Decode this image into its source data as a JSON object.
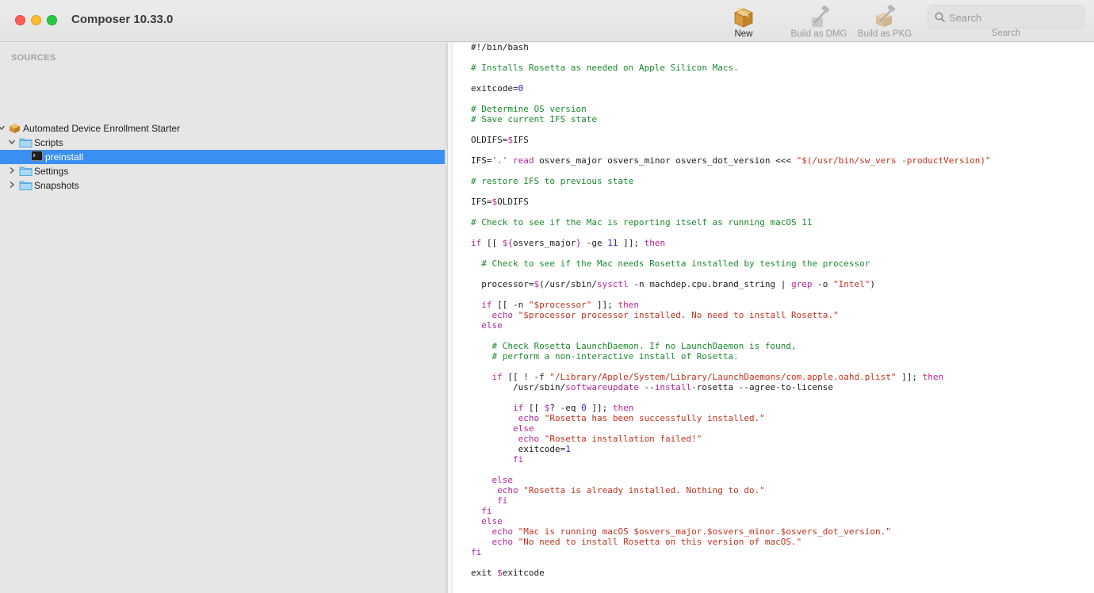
{
  "app": {
    "title": "Composer 10.33.0"
  },
  "toolbar": {
    "new_label": "New",
    "dmg_label": "Build as DMG",
    "pkg_label": "Build as PKG",
    "search_placeholder": "Search",
    "search_caption": "Search"
  },
  "sidebar": {
    "header": "SOURCES",
    "package": "Automated Device Enrollment Starter",
    "items": {
      "scripts": "Scripts",
      "preinstall": "preinstall",
      "settings": "Settings",
      "snapshots": "Snapshots"
    }
  },
  "colors": {
    "comment": "#1c8a2e",
    "keyword": "#b4269a",
    "string": "#c2321f",
    "number": "#2727c9",
    "selection": "#3a8ff2"
  },
  "script_lines": [
    [
      [
        "t",
        "#!/bin/bash"
      ]
    ],
    [],
    [
      [
        "c",
        "# Installs Rosetta as needed on Apple Silicon Macs."
      ]
    ],
    [],
    [
      [
        "t",
        "exitcode="
      ],
      [
        "n",
        "0"
      ]
    ],
    [],
    [
      [
        "c",
        "# Determine OS version"
      ]
    ],
    [
      [
        "c",
        "# Save current IFS state"
      ]
    ],
    [],
    [
      [
        "t",
        "OLDIFS="
      ],
      [
        "k",
        "$"
      ],
      [
        "t",
        "IFS"
      ]
    ],
    [],
    [
      [
        "t",
        "IFS="
      ],
      [
        "s",
        "'.'"
      ],
      [
        "t",
        " "
      ],
      [
        "k",
        "read"
      ],
      [
        "t",
        " osvers_major osvers_minor osvers_dot_version <<< "
      ],
      [
        "s",
        "\"$(/usr/bin/sw_vers -productVersion)\""
      ]
    ],
    [],
    [
      [
        "c",
        "# restore IFS to previous state"
      ]
    ],
    [],
    [
      [
        "t",
        "IFS="
      ],
      [
        "k",
        "$"
      ],
      [
        "t",
        "OLDIFS"
      ]
    ],
    [],
    [
      [
        "c",
        "# Check to see if the Mac is reporting itself as running macOS 11"
      ]
    ],
    [],
    [
      [
        "k",
        "if"
      ],
      [
        "t",
        " [[ "
      ],
      [
        "k",
        "${"
      ],
      [
        "t",
        "osvers_major"
      ],
      [
        "k",
        "}"
      ],
      [
        "t",
        " -ge "
      ],
      [
        "n",
        "11"
      ],
      [
        "t",
        " ]]; "
      ],
      [
        "k",
        "then"
      ]
    ],
    [],
    [
      [
        "t",
        "  "
      ],
      [
        "c",
        "# Check to see if the Mac needs Rosetta installed by testing the processor"
      ]
    ],
    [],
    [
      [
        "t",
        "  processor="
      ],
      [
        "k",
        "$"
      ],
      [
        "t",
        "(/usr/sbin/"
      ],
      [
        "k",
        "sysctl"
      ],
      [
        "t",
        " -n machdep.cpu.brand_string | "
      ],
      [
        "k",
        "grep"
      ],
      [
        "t",
        " -o "
      ],
      [
        "s",
        "\"Intel\""
      ],
      [
        "t",
        ")"
      ]
    ],
    [],
    [
      [
        "t",
        "  "
      ],
      [
        "k",
        "if"
      ],
      [
        "t",
        " [[ -n "
      ],
      [
        "s",
        "\"$processor\""
      ],
      [
        "t",
        " ]]; "
      ],
      [
        "k",
        "then"
      ]
    ],
    [
      [
        "t",
        "    "
      ],
      [
        "k",
        "echo"
      ],
      [
        "t",
        " "
      ],
      [
        "s",
        "\"$processor processor installed. No need to install Rosetta.\""
      ]
    ],
    [
      [
        "t",
        "  "
      ],
      [
        "k",
        "else"
      ]
    ],
    [],
    [
      [
        "t",
        "    "
      ],
      [
        "c",
        "# Check Rosetta LaunchDaemon. If no LaunchDaemon is found,"
      ]
    ],
    [
      [
        "t",
        "    "
      ],
      [
        "c",
        "# perform a non-interactive install of Rosetta."
      ]
    ],
    [],
    [
      [
        "t",
        "    "
      ],
      [
        "k",
        "if"
      ],
      [
        "t",
        " [[ ! -f "
      ],
      [
        "s",
        "\"/Library/Apple/System/Library/LaunchDaemons/com.apple.oahd.plist\""
      ],
      [
        "t",
        " ]]; "
      ],
      [
        "k",
        "then"
      ]
    ],
    [
      [
        "t",
        "        /usr/sbin/"
      ],
      [
        "k",
        "softwareupdate"
      ],
      [
        "t",
        " --"
      ],
      [
        "k",
        "install"
      ],
      [
        "t",
        "-rosetta --agree-to-license"
      ]
    ],
    [],
    [
      [
        "t",
        "        "
      ],
      [
        "k",
        "if"
      ],
      [
        "t",
        " [[ "
      ],
      [
        "k",
        "$"
      ],
      [
        "t",
        "? -eq "
      ],
      [
        "n",
        "0"
      ],
      [
        "t",
        " ]]; "
      ],
      [
        "k",
        "then"
      ]
    ],
    [
      [
        "t",
        "         "
      ],
      [
        "k",
        "echo"
      ],
      [
        "t",
        " "
      ],
      [
        "s",
        "\"Rosetta has been successfully installed.\""
      ]
    ],
    [
      [
        "t",
        "        "
      ],
      [
        "k",
        "else"
      ]
    ],
    [
      [
        "t",
        "         "
      ],
      [
        "k",
        "echo"
      ],
      [
        "t",
        " "
      ],
      [
        "s",
        "\"Rosetta installation failed!\""
      ]
    ],
    [
      [
        "t",
        "         exitcode="
      ],
      [
        "n",
        "1"
      ]
    ],
    [
      [
        "t",
        "        "
      ],
      [
        "k",
        "fi"
      ]
    ],
    [],
    [
      [
        "t",
        "    "
      ],
      [
        "k",
        "else"
      ]
    ],
    [
      [
        "t",
        "     "
      ],
      [
        "k",
        "echo"
      ],
      [
        "t",
        " "
      ],
      [
        "s",
        "\"Rosetta is already installed. Nothing to do.\""
      ]
    ],
    [
      [
        "t",
        "     "
      ],
      [
        "k",
        "fi"
      ]
    ],
    [
      [
        "t",
        "  "
      ],
      [
        "k",
        "fi"
      ]
    ],
    [
      [
        "t",
        "  "
      ],
      [
        "k",
        "else"
      ]
    ],
    [
      [
        "t",
        "    "
      ],
      [
        "k",
        "echo"
      ],
      [
        "t",
        " "
      ],
      [
        "s",
        "\"Mac is running macOS $osvers_major.$osvers_minor.$osvers_dot_version.\""
      ]
    ],
    [
      [
        "t",
        "    "
      ],
      [
        "k",
        "echo"
      ],
      [
        "t",
        " "
      ],
      [
        "s",
        "\"No need to install Rosetta on this version of macOS.\""
      ]
    ],
    [
      [
        "k",
        "fi"
      ]
    ],
    [],
    [
      [
        "t",
        "exit "
      ],
      [
        "k",
        "$"
      ],
      [
        "t",
        "exitcode"
      ]
    ]
  ]
}
